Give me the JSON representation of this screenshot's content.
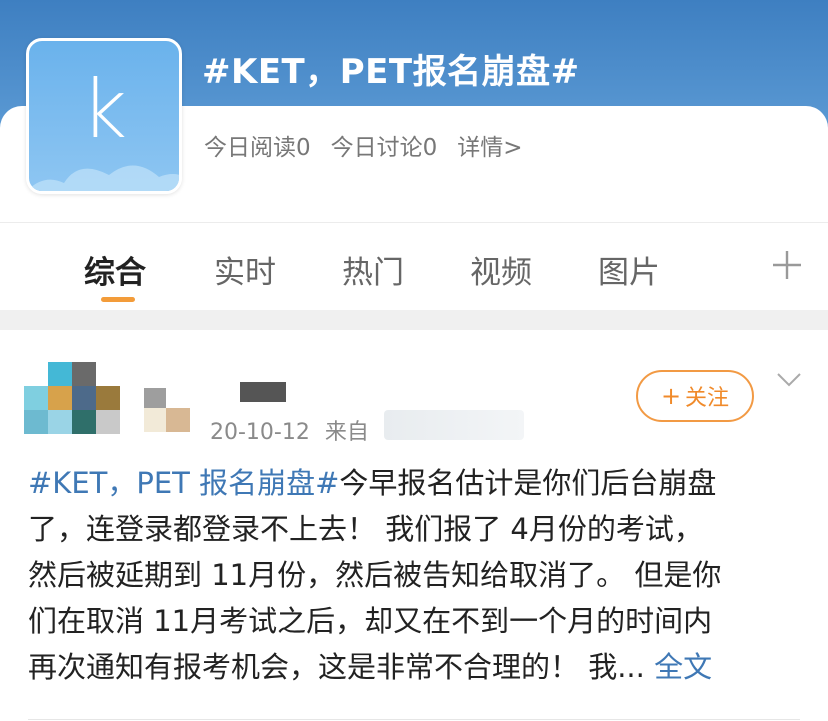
{
  "topic": {
    "title": "#KET，PET报名崩盘#",
    "avatar_letter": "k",
    "stats": {
      "reads": "今日阅读0",
      "discussions": "今日讨论0",
      "details": "详情>"
    }
  },
  "tabs": [
    {
      "label": "综合",
      "active": true
    },
    {
      "label": "实时",
      "active": false
    },
    {
      "label": "热门",
      "active": false
    },
    {
      "label": "视频",
      "active": false
    },
    {
      "label": "图片",
      "active": false
    }
  ],
  "post": {
    "date": "20-10-12",
    "source_prefix": "来自",
    "follow_label": "关注",
    "follow_plus": "+",
    "lines": [
      {
        "hashtag": "#KET，PET 报名崩盘#",
        "text": "今早报名估计是你们后台崩盘"
      },
      {
        "text": "了，连登录都登录不上去！ 我们报了 4月份的考试，"
      },
      {
        "text": "然后被延期到 11月份，然后被告知给取消了。 但是你"
      },
      {
        "text": "们在取消 11月考试之后，却又在不到一个月的时间内"
      },
      {
        "text": "再次通知有报考机会，这是非常不合理的！ 我...",
        "more": "全文"
      }
    ]
  },
  "colors": {
    "header_blue": "#4a89c8",
    "link_blue": "#3f78b5",
    "accent_orange": "#f08a2a"
  }
}
